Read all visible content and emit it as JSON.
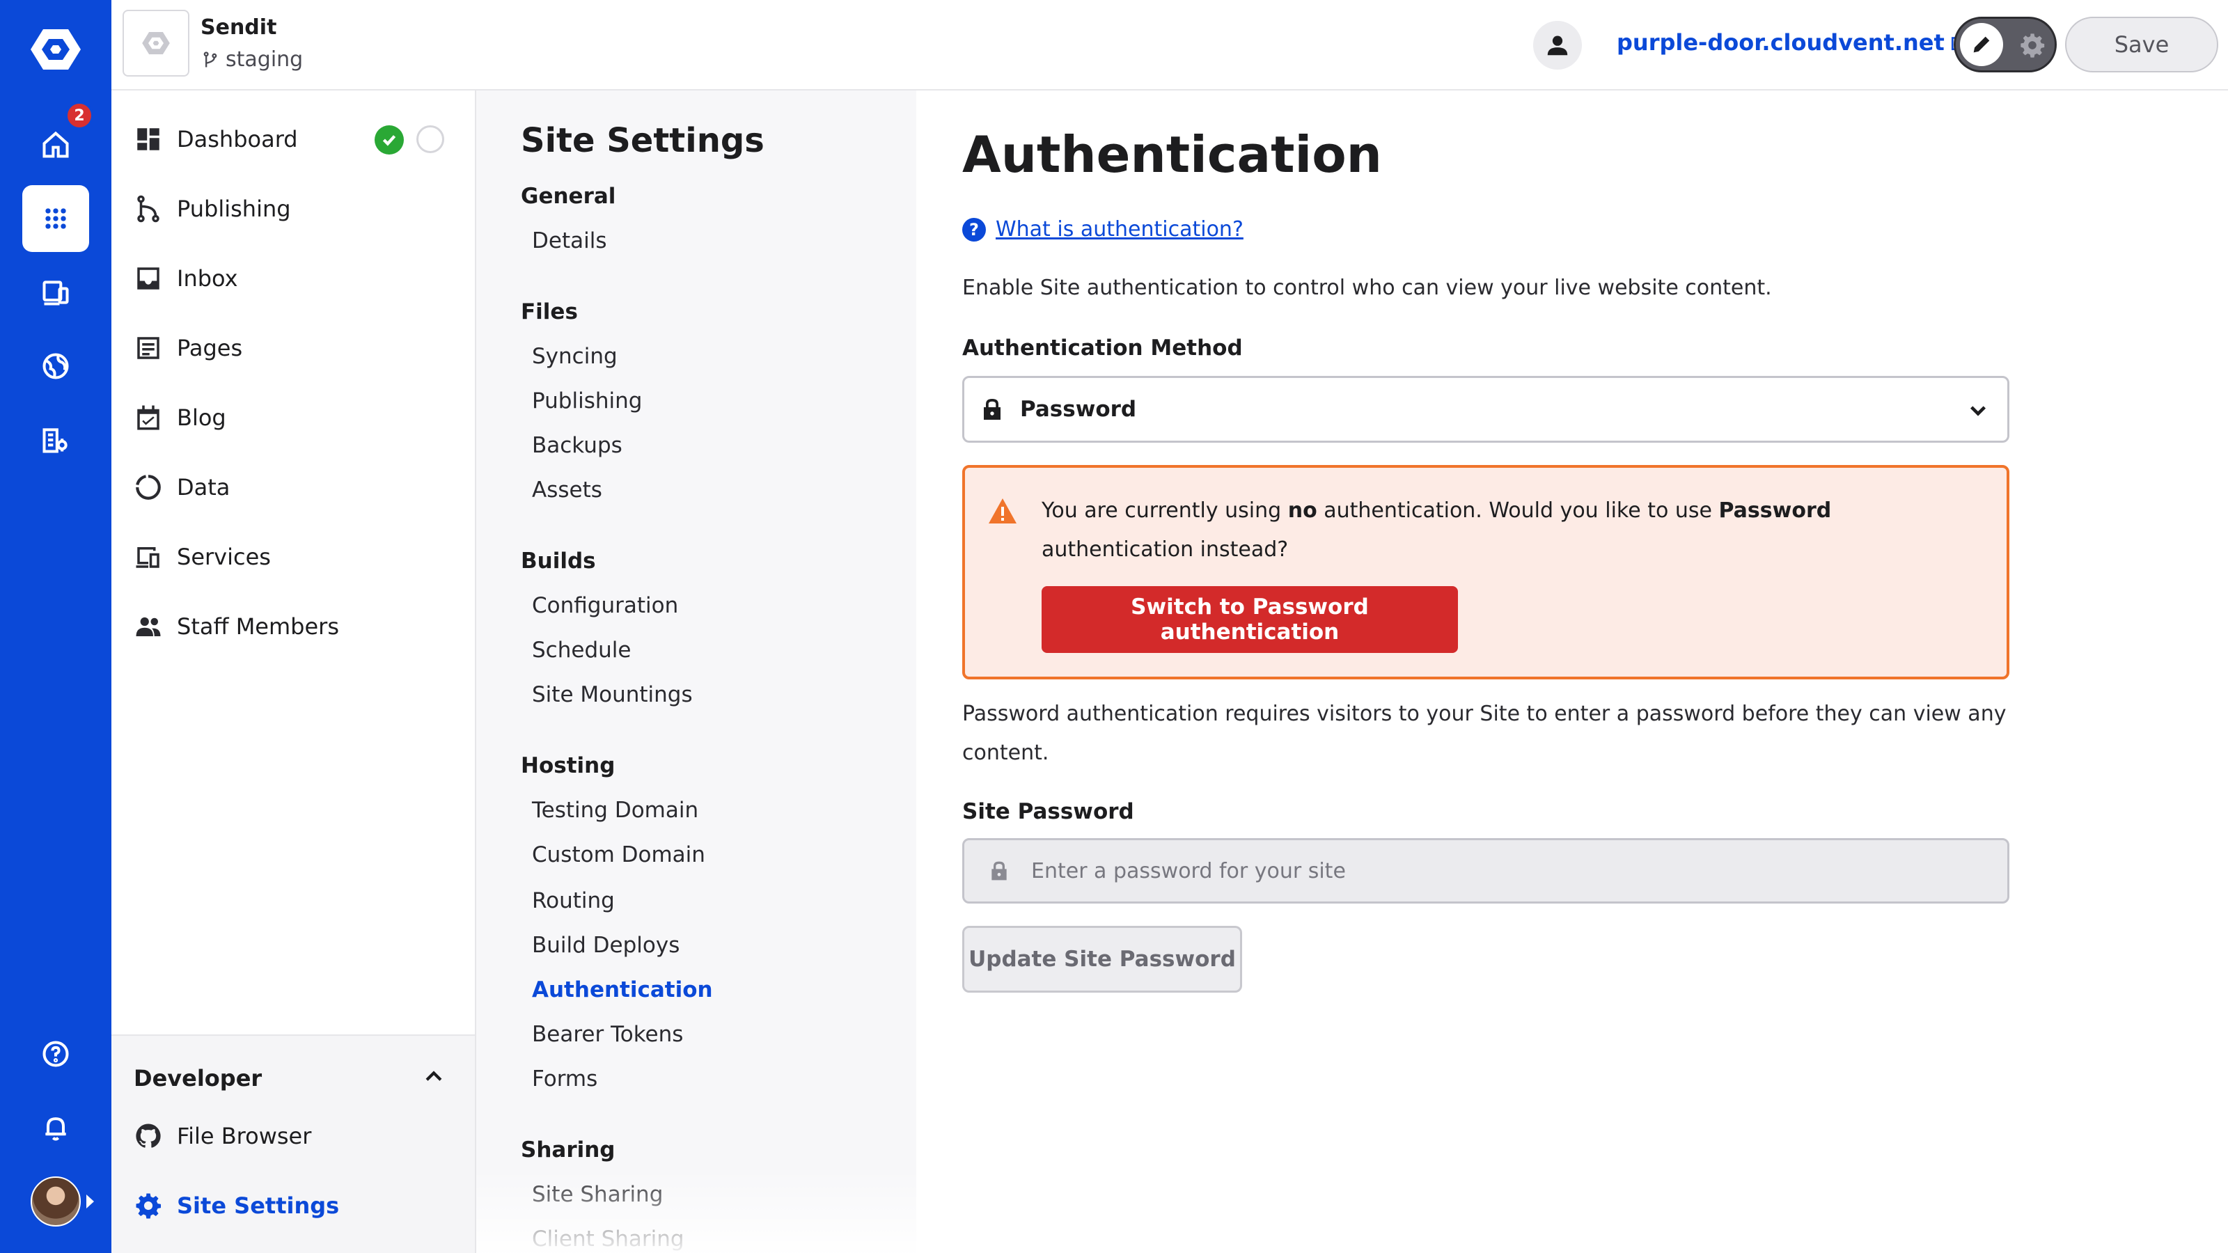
{
  "rail": {
    "home_badge_count": "2",
    "colors": {
      "brand_blue": "#0b49d8",
      "badge_red": "#d83030"
    }
  },
  "topbar": {
    "site_name": "Sendit",
    "branch": "staging",
    "domain": "purple-door.cloudvent.net",
    "save_label": "Save"
  },
  "nav": {
    "items": [
      {
        "label": "Dashboard"
      },
      {
        "label": "Publishing"
      },
      {
        "label": "Inbox"
      },
      {
        "label": "Pages"
      },
      {
        "label": "Blog"
      },
      {
        "label": "Data"
      },
      {
        "label": "Services"
      },
      {
        "label": "Staff Members"
      }
    ],
    "developer": {
      "title": "Developer",
      "items": [
        {
          "label": "File Browser"
        },
        {
          "label": "Site Settings"
        }
      ]
    }
  },
  "settings_nav": {
    "title": "Site Settings",
    "groups": [
      {
        "label": "General",
        "links": [
          "Details"
        ]
      },
      {
        "label": "Files",
        "links": [
          "Syncing",
          "Publishing",
          "Backups",
          "Assets"
        ]
      },
      {
        "label": "Builds",
        "links": [
          "Configuration",
          "Schedule",
          "Site Mountings"
        ]
      },
      {
        "label": "Hosting",
        "links": [
          "Testing Domain",
          "Custom Domain",
          "Routing",
          "Build Deploys",
          "Authentication",
          "Bearer Tokens",
          "Forms"
        ]
      },
      {
        "label": "Sharing",
        "links": [
          "Site Sharing",
          "Client Sharing"
        ]
      }
    ],
    "current": "Authentication"
  },
  "main": {
    "title": "Authentication",
    "help_link": "What is authentication?",
    "description": "Enable Site authentication to control who can view your live website content.",
    "method_label": "Authentication Method",
    "method_value": "Password",
    "alert": {
      "text_1": "You are currently using ",
      "bold_1": "no",
      "text_2": " authentication. Would you like to use ",
      "bold_2": "Password",
      "text_3": " authentication instead?",
      "button_label": "Switch to Password authentication",
      "colors": {
        "background": "#fdebe5",
        "border": "#f0742b",
        "button": "#d32a2a"
      }
    },
    "password_description": "Password authentication requires visitors to your Site to enter a password before they can view any content.",
    "password_label": "Site Password",
    "password_placeholder": "Enter a password for your site",
    "update_button_label": "Update Site Password"
  }
}
